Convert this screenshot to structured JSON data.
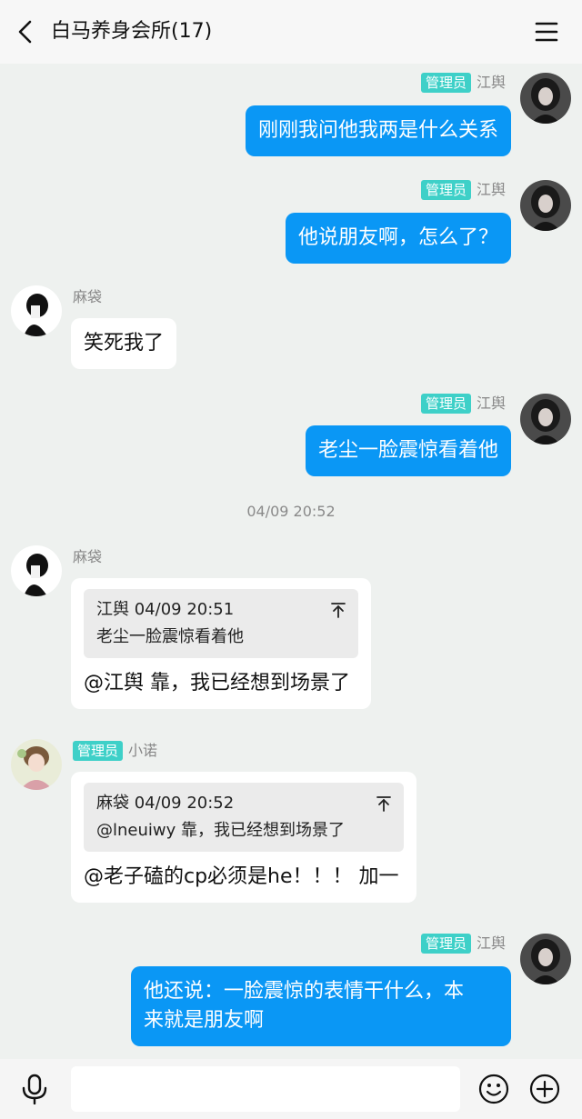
{
  "header": {
    "title": "白马养身会所(17)"
  },
  "badge_label": "管理员",
  "timestamp": "04/09 20:52",
  "messages": [
    {
      "sender": "江舆",
      "text": "刚刚我问他我两是什么关系"
    },
    {
      "sender": "江舆",
      "text": "他说朋友啊，怎么了？"
    },
    {
      "sender": "麻袋",
      "text": "笑死我了"
    },
    {
      "sender": "江舆",
      "text": "老尘一脸震惊看着他"
    },
    {
      "sender": "麻袋",
      "quote_header": "江舆 04/09 20:51",
      "quote_text": "老尘一脸震惊看着他",
      "text": "@江舆 靠，我已经想到场景了"
    },
    {
      "sender": "小诺",
      "quote_header": "麻袋 04/09 20:52",
      "quote_text": "@lneuiwy 靠，我已经想到场景了",
      "text": "@老子磕的cp必须是he！！！ 加一"
    },
    {
      "sender": "江舆",
      "text_line1": "他还说：一脸震惊的表情干什么，本",
      "text_line2": "来就是朋友啊"
    }
  ],
  "colors": {
    "outgoing_bubble": "#0a97f5",
    "admin_badge": "#3ed0c8",
    "background": "#eef1ef"
  },
  "icons": [
    "back-arrow-icon",
    "menu-icon",
    "microphone-icon",
    "emoji-icon",
    "plus-icon",
    "pin-top-icon"
  ]
}
